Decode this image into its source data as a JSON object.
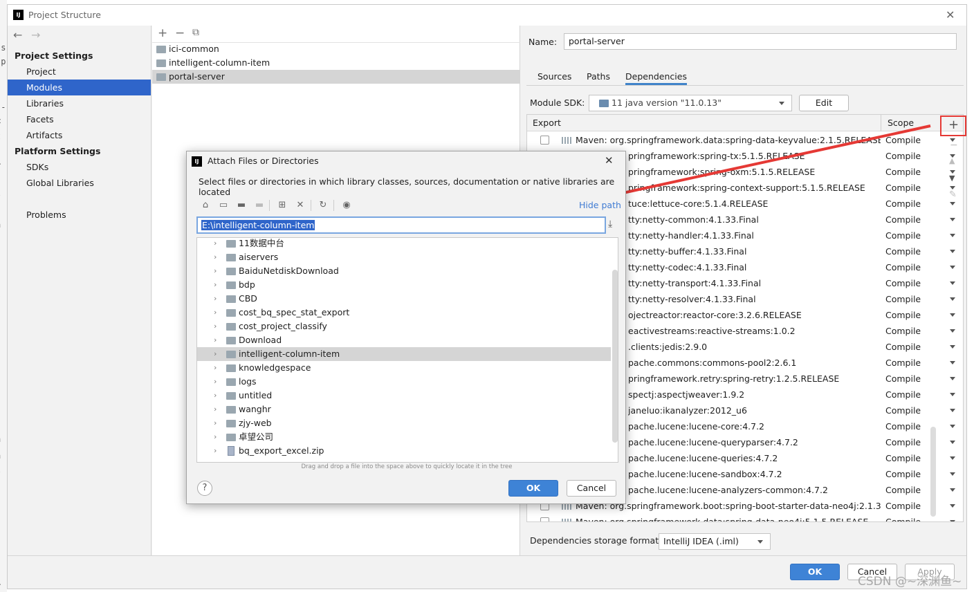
{
  "window": {
    "title": "Project Structure"
  },
  "sidebar": {
    "project_settings_heading": "Project Settings",
    "project_items": [
      "Project",
      "Modules",
      "Libraries",
      "Facets",
      "Artifacts"
    ],
    "platform_settings_heading": "Platform Settings",
    "platform_items": [
      "SDKs",
      "Global Libraries"
    ],
    "problems": "Problems",
    "selected": "Modules"
  },
  "modules": {
    "items": [
      "ici-common",
      "intelligent-column-item",
      "portal-server"
    ],
    "selected": "portal-server"
  },
  "details": {
    "name_label": "Name:",
    "name_value": "portal-server",
    "tabs": [
      "Sources",
      "Paths",
      "Dependencies"
    ],
    "active_tab": "Dependencies",
    "sdk_label": "Module SDK:",
    "sdk_value": "11  java version \"11.0.13\"",
    "edit_button": "Edit",
    "col_export": "Export",
    "col_scope": "Scope",
    "add_button": "+",
    "dependencies": [
      {
        "name": "Maven: org.springframework.data:spring-data-keyvalue:2.1.5.RELEASE",
        "scope": "Compile"
      },
      {
        "name": "pringframework:spring-tx:5.1.5.RELEASE",
        "scope": "Compile"
      },
      {
        "name": "pringframework:spring-oxm:5.1.5.RELEASE",
        "scope": "Compile"
      },
      {
        "name": "pringframework:spring-context-support:5.1.5.RELEASE",
        "scope": "Compile"
      },
      {
        "name": "tuce:lettuce-core:5.1.4.RELEASE",
        "scope": "Compile"
      },
      {
        "name": "tty:netty-common:4.1.33.Final",
        "scope": "Compile"
      },
      {
        "name": "tty:netty-handler:4.1.33.Final",
        "scope": "Compile"
      },
      {
        "name": "tty:netty-buffer:4.1.33.Final",
        "scope": "Compile"
      },
      {
        "name": "tty:netty-codec:4.1.33.Final",
        "scope": "Compile"
      },
      {
        "name": "tty:netty-transport:4.1.33.Final",
        "scope": "Compile"
      },
      {
        "name": "tty:netty-resolver:4.1.33.Final",
        "scope": "Compile"
      },
      {
        "name": "ojectreactor:reactor-core:3.2.6.RELEASE",
        "scope": "Compile"
      },
      {
        "name": "eactivestreams:reactive-streams:1.0.2",
        "scope": "Compile"
      },
      {
        "name": ".clients:jedis:2.9.0",
        "scope": "Compile"
      },
      {
        "name": "pache.commons:commons-pool2:2.6.1",
        "scope": "Compile"
      },
      {
        "name": "pringframework.retry:spring-retry:1.2.5.RELEASE",
        "scope": "Compile"
      },
      {
        "name": "spectj:aspectjweaver:1.9.2",
        "scope": "Compile"
      },
      {
        "name": "janeluo:ikanalyzer:2012_u6",
        "scope": "Compile"
      },
      {
        "name": "pache.lucene:lucene-core:4.7.2",
        "scope": "Compile"
      },
      {
        "name": "pache.lucene:lucene-queryparser:4.7.2",
        "scope": "Compile"
      },
      {
        "name": "pache.lucene:lucene-queries:4.7.2",
        "scope": "Compile"
      },
      {
        "name": "pache.lucene:lucene-sandbox:4.7.2",
        "scope": "Compile"
      },
      {
        "name": "pache.lucene:lucene-analyzers-common:4.7.2",
        "scope": "Compile"
      },
      {
        "name": "Maven: org.springframework.boot:spring-boot-starter-data-neo4j:2.1.3.RELI",
        "scope": "Compile"
      },
      {
        "name": "Maven: org.springframework.data:spring-data-neo4j:5.1.5.RELEASE",
        "scope": "Compile"
      }
    ],
    "storage_label": "Dependencies storage format:",
    "storage_value": "IntelliJ IDEA (.iml)"
  },
  "footer": {
    "ok": "OK",
    "cancel": "Cancel",
    "apply": "Apply"
  },
  "watermark": "CSDN @~深渊鱼~",
  "dialog": {
    "title": "Attach Files or Directories",
    "description": "Select files or directories in which library classes, sources, documentation or native libraries are located",
    "hide_path": "Hide path",
    "path_value": "E:\\intelligent-column-item",
    "tree_items": [
      "11数据中台",
      "aiservers",
      "BaiduNetdiskDownload",
      "bdp",
      "CBD",
      "cost_bq_spec_stat_export",
      "cost_project_classify",
      "Download",
      "intelligent-column-item",
      "knowledgespace",
      "logs",
      "untitled",
      "wanghr",
      "zjy-web",
      "卓望公司",
      "bq_export_excel.zip"
    ],
    "selected_tree_item": "intelligent-column-item",
    "drag_hint": "Drag and drop a file into the space above to quickly locate it in the tree",
    "help": "?",
    "ok": "OK",
    "cancel": "Cancel"
  },
  "colors": {
    "selection": "#2f65ca",
    "primary_button": "#3e83d6",
    "annotation_red": "#e53935"
  }
}
